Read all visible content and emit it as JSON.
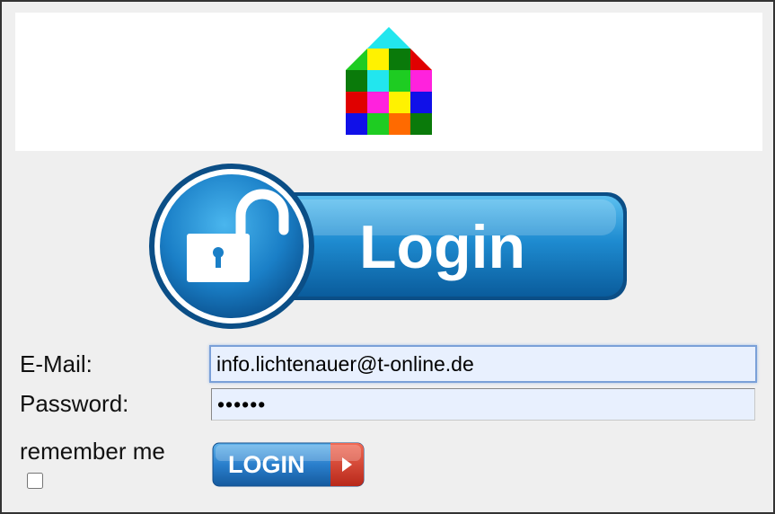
{
  "header": {
    "logo_icon": "colorful-house-icon",
    "house_colors": {
      "roof": "#22e6ee",
      "row1": [
        "#1ecc22",
        "#fff200",
        "#0a7a0a",
        "#e00000"
      ],
      "row2": [
        "#0a7a0a",
        "#22e6ee",
        "#1ecc22",
        "#ff22dd"
      ],
      "row3": [
        "#e00000",
        "#ff22dd",
        "#fff200",
        "#1010e8"
      ],
      "row4": [
        "#1010e8",
        "#1ecc22",
        "#ff6a00",
        "#0a7a0a"
      ]
    }
  },
  "banner": {
    "label": "Login",
    "icon": "unlocked-padlock-icon",
    "color": "#1a7fc7"
  },
  "form": {
    "email_label": "E-Mail:",
    "email_value": "info.lichtenauer@t-online.de",
    "password_label": "Password:",
    "password_value": "••••••",
    "remember_label": "remember me",
    "remember_checked": false,
    "submit_label": "LOGIN",
    "submit_icon": "play-arrow-icon"
  }
}
